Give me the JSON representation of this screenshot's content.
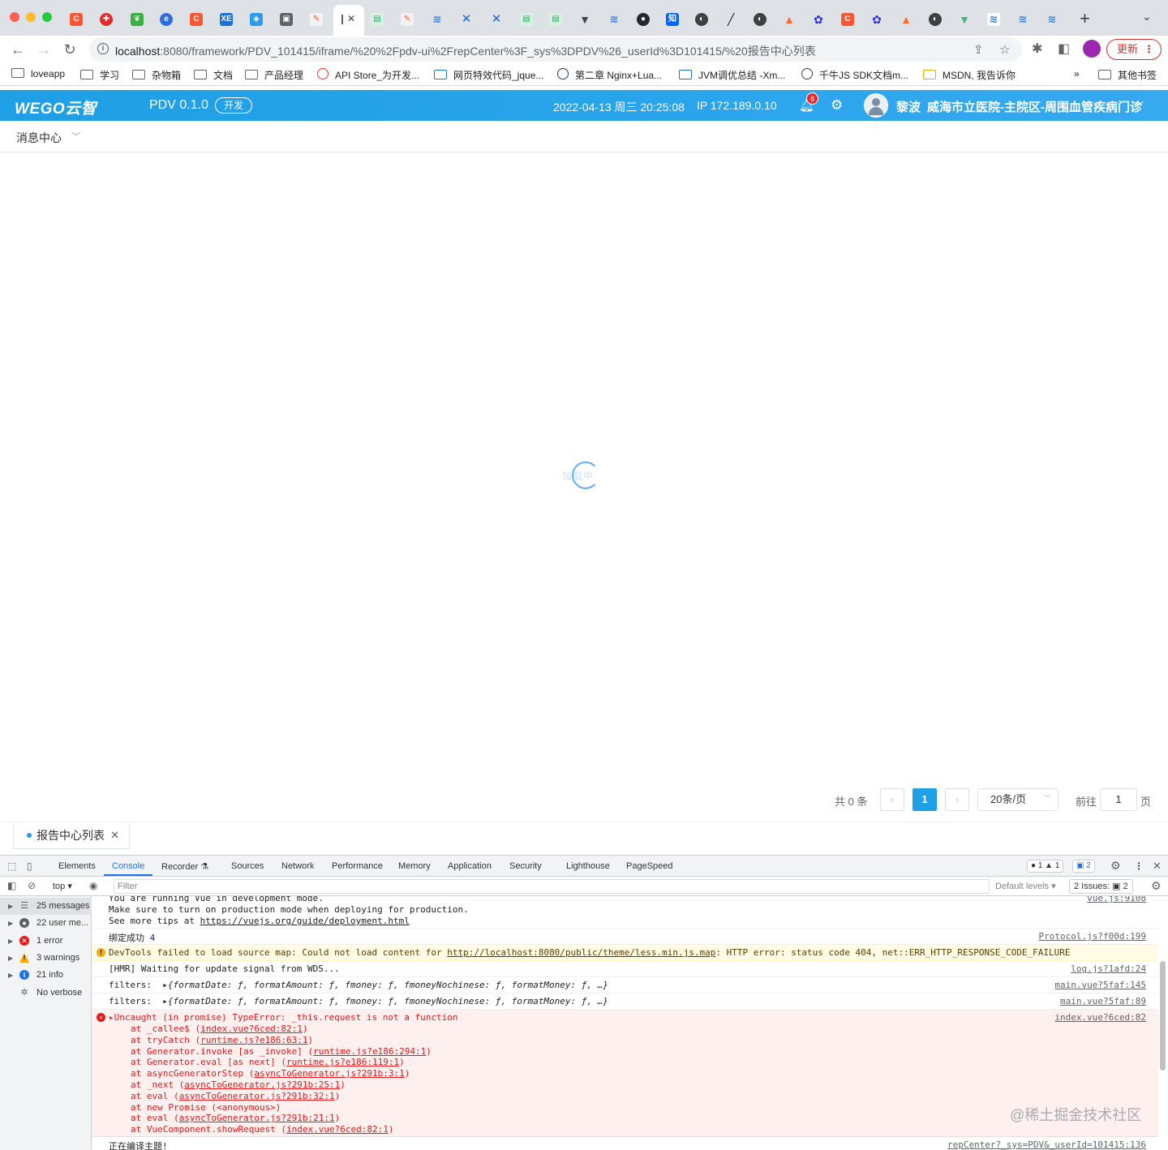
{
  "browser": {
    "tab_icons": [
      "csdn-icon",
      "csdn-icon",
      "leaf-icon",
      "edge-icon",
      "csdn-icon",
      "xe-icon",
      "cube-icon",
      "image-icon",
      "postman-icon",
      "active",
      "doc-icon",
      "postman-icon",
      "yuque-icon",
      "confluence-icon",
      "confluence-icon",
      "doc-icon",
      "doc-icon",
      "vue-icon",
      "yuque-icon",
      "github-icon",
      "zhihu-icon",
      "globe-icon",
      "pen-icon",
      "globe-icon",
      "gitlab-icon",
      "baidu-icon",
      "csdn-icon",
      "baidu-icon",
      "gitlab-icon",
      "globe-icon",
      "vue-icon",
      "yuque-icon",
      "yuque-icon",
      "yuque-icon"
    ],
    "active_tab_close": "✕",
    "new_tab": "+",
    "url_host": "localhost",
    "url_path": ":8080/framework/PDV_101415/iframe/%20%2Fpdv-ui%2FrepCenter%3F_sys%3DPDV%26_userId%3D101415/%20报告中心列表",
    "update_label": "更新",
    "bookmarks": [
      "loveapp",
      "学习",
      "杂物箱",
      "文档",
      "产品经理",
      "API Store_为开发...",
      "网页特效代码_jque...",
      "第二章 Nginx+Lua...",
      "JVM调优总结 -Xm...",
      "千牛JS SDK文档m...",
      "MSDN, 我告诉你"
    ],
    "bookmarks_overflow": "»",
    "other_bookmarks": "其他书签"
  },
  "app": {
    "logo": "WEGO云智",
    "name": "PDV 0.1.0",
    "env": "开发",
    "datetime": "2022-04-13 周三 20:25:08",
    "ip": "IP 172.189.0.10",
    "notifications": "8",
    "user": "黎波",
    "hospital": "威海市立医院-主院区-周围血管疾病门诊",
    "subnav_title": "消息中心",
    "loading_text": "加载中"
  },
  "pagination": {
    "total": "共 0 条",
    "prev": "‹",
    "current": "1",
    "next": "›",
    "page_size": "20条/页",
    "goto_label": "前往",
    "goto_value": "1",
    "unit": "页"
  },
  "bottom_tab": {
    "label": "报告中心列表",
    "close": "✕"
  },
  "devtools": {
    "tabs": [
      "Elements",
      "Console",
      "Recorder ⚗",
      "Sources",
      "Network",
      "Performance",
      "Memory",
      "Application",
      "Security",
      "Lighthouse",
      "PageSpeed"
    ],
    "active_tab": "Console",
    "counts": "● 1 ▲ 1",
    "message_count": "▣ 2",
    "context": "top ▾",
    "filter_placeholder": "Filter",
    "levels": "Default levels ▾",
    "issues": "2 Issues: ▣ 2",
    "sidebar": [
      {
        "label": "25 messages",
        "icon": "list-icon"
      },
      {
        "label": "22 user me...",
        "icon": "user-icon"
      },
      {
        "label": "1 error",
        "icon": "error-icon"
      },
      {
        "label": "3 warnings",
        "icon": "warning-icon"
      },
      {
        "label": "21 info",
        "icon": "info-icon"
      },
      {
        "label": "No verbose",
        "icon": "bug-icon"
      }
    ],
    "logs": {
      "l1a": "You are running Vue in development mode.",
      "l1b": "Make sure to turn on production mode when deploying for production.",
      "l1c_pre": "See more tips at ",
      "l1c_link": "https://vuejs.org/guide/deployment.html",
      "l1_src": "vue.js:9108",
      "l2": "绑定成功",
      "l2_num": "4",
      "l2_src": "Protocol.js?f00d:199",
      "l3_pre": "DevTools failed to load source map: Could not load content for ",
      "l3_link": "http://localhost:8080/public/theme/less.min.js.map",
      "l3_post": ": HTTP error: status code 404, net::ERR_HTTP_RESPONSE_CODE_FAILURE",
      "l4": "[HMR] Waiting for update signal from WDS...",
      "l4_src": "log.js?1afd:24",
      "l5_label": "filters:",
      "l5_obj": "▸{formatDate: ƒ, formatAmount: ƒ, fmoney: ƒ, fmoneyNochinese: ƒ, formatMoney: ƒ, …}",
      "l5_src": "main.vue?5faf:145",
      "l6_src": "main.vue?5faf:89",
      "err_head": "▸Uncaught (in promise) TypeError: _this.request is not a function",
      "err_src": "index.vue?6ced:82",
      "stack": [
        [
          "at _callee$ (",
          "index.vue?6ced:82:1",
          ")"
        ],
        [
          "at tryCatch (",
          "runtime.js?e186:63:1",
          ")"
        ],
        [
          "at Generator.invoke [as _invoke] (",
          "runtime.js?e186:294:1",
          ")"
        ],
        [
          "at Generator.eval [as next] (",
          "runtime.js?e186:119:1",
          ")"
        ],
        [
          "at asyncGeneratorStep (",
          "asyncToGenerator.js?291b:3:1",
          ")"
        ],
        [
          "at _next (",
          "asyncToGenerator.js?291b:25:1",
          ")"
        ],
        [
          "at eval (",
          "asyncToGenerator.js?291b:32:1",
          ")"
        ],
        [
          "at new Promise (<anonymous>)",
          "",
          ""
        ],
        [
          "at eval (",
          "asyncToGenerator.js?291b:21:1",
          ")"
        ],
        [
          "at VueComponent.showRequest (",
          "index.vue?6ced:82:1",
          ")"
        ]
      ],
      "last": "正在编译主题!",
      "last_src": "repCenter?_sys=PDV&_userId=101415:136"
    }
  },
  "watermark": "@稀土掘金技术社区"
}
